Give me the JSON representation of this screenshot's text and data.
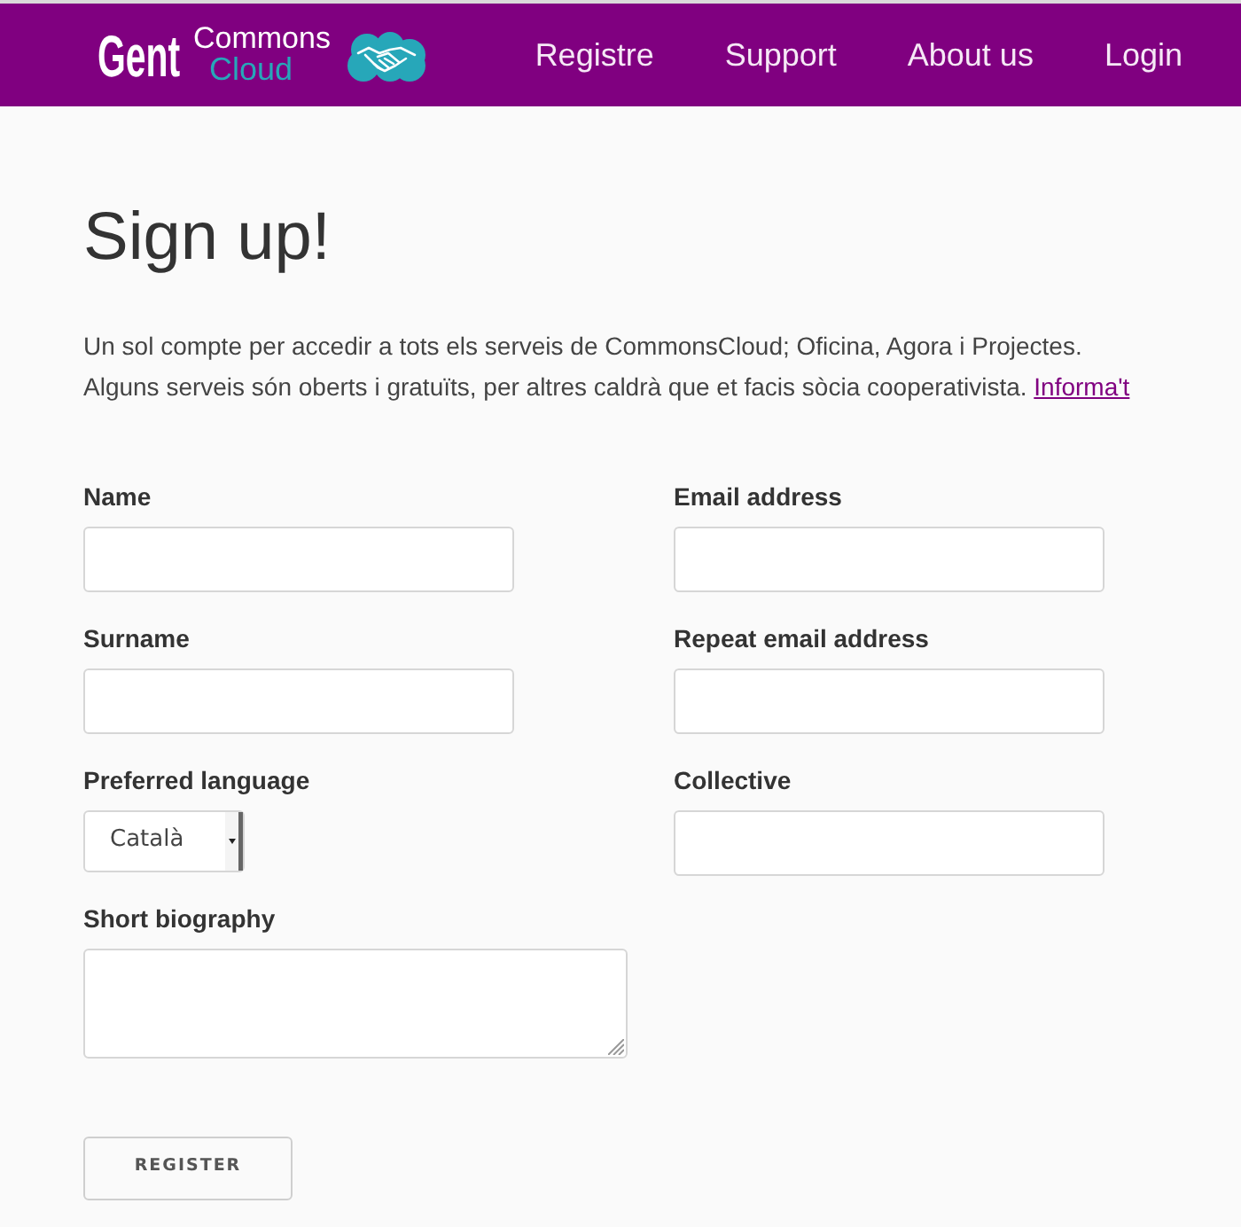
{
  "navbar": {
    "logo": {
      "part_1": "Gent",
      "part_2": "Commons",
      "part_3": "Cloud"
    },
    "links": [
      "Registre",
      "Support",
      "About us",
      "Login"
    ]
  },
  "heading": "Sign up!",
  "intro": {
    "lines": [
      "Un sol compte per accedir a tots els serveis de CommonsCloud; Oficina, Agora i Projectes.",
      "Alguns serveis són oberts i gratuïts, per altres caldrà que et facis sòcia cooperativista."
    ],
    "link": "Informa't"
  },
  "form": {
    "columns": [
      {
        "fields": [
          {
            "kind": "text",
            "label": "Name"
          },
          {
            "kind": "text",
            "label": "Surname"
          },
          {
            "kind": "select",
            "label": "Preferred language",
            "value": "Català"
          },
          {
            "kind": "textarea",
            "label": "Short biography"
          }
        ]
      },
      {
        "fields": [
          {
            "kind": "text",
            "label": "Email address"
          },
          {
            "kind": "text",
            "label": "Repeat email address"
          },
          {
            "kind": "text",
            "label": "Collective"
          }
        ]
      }
    ],
    "button": "REGISTER"
  }
}
